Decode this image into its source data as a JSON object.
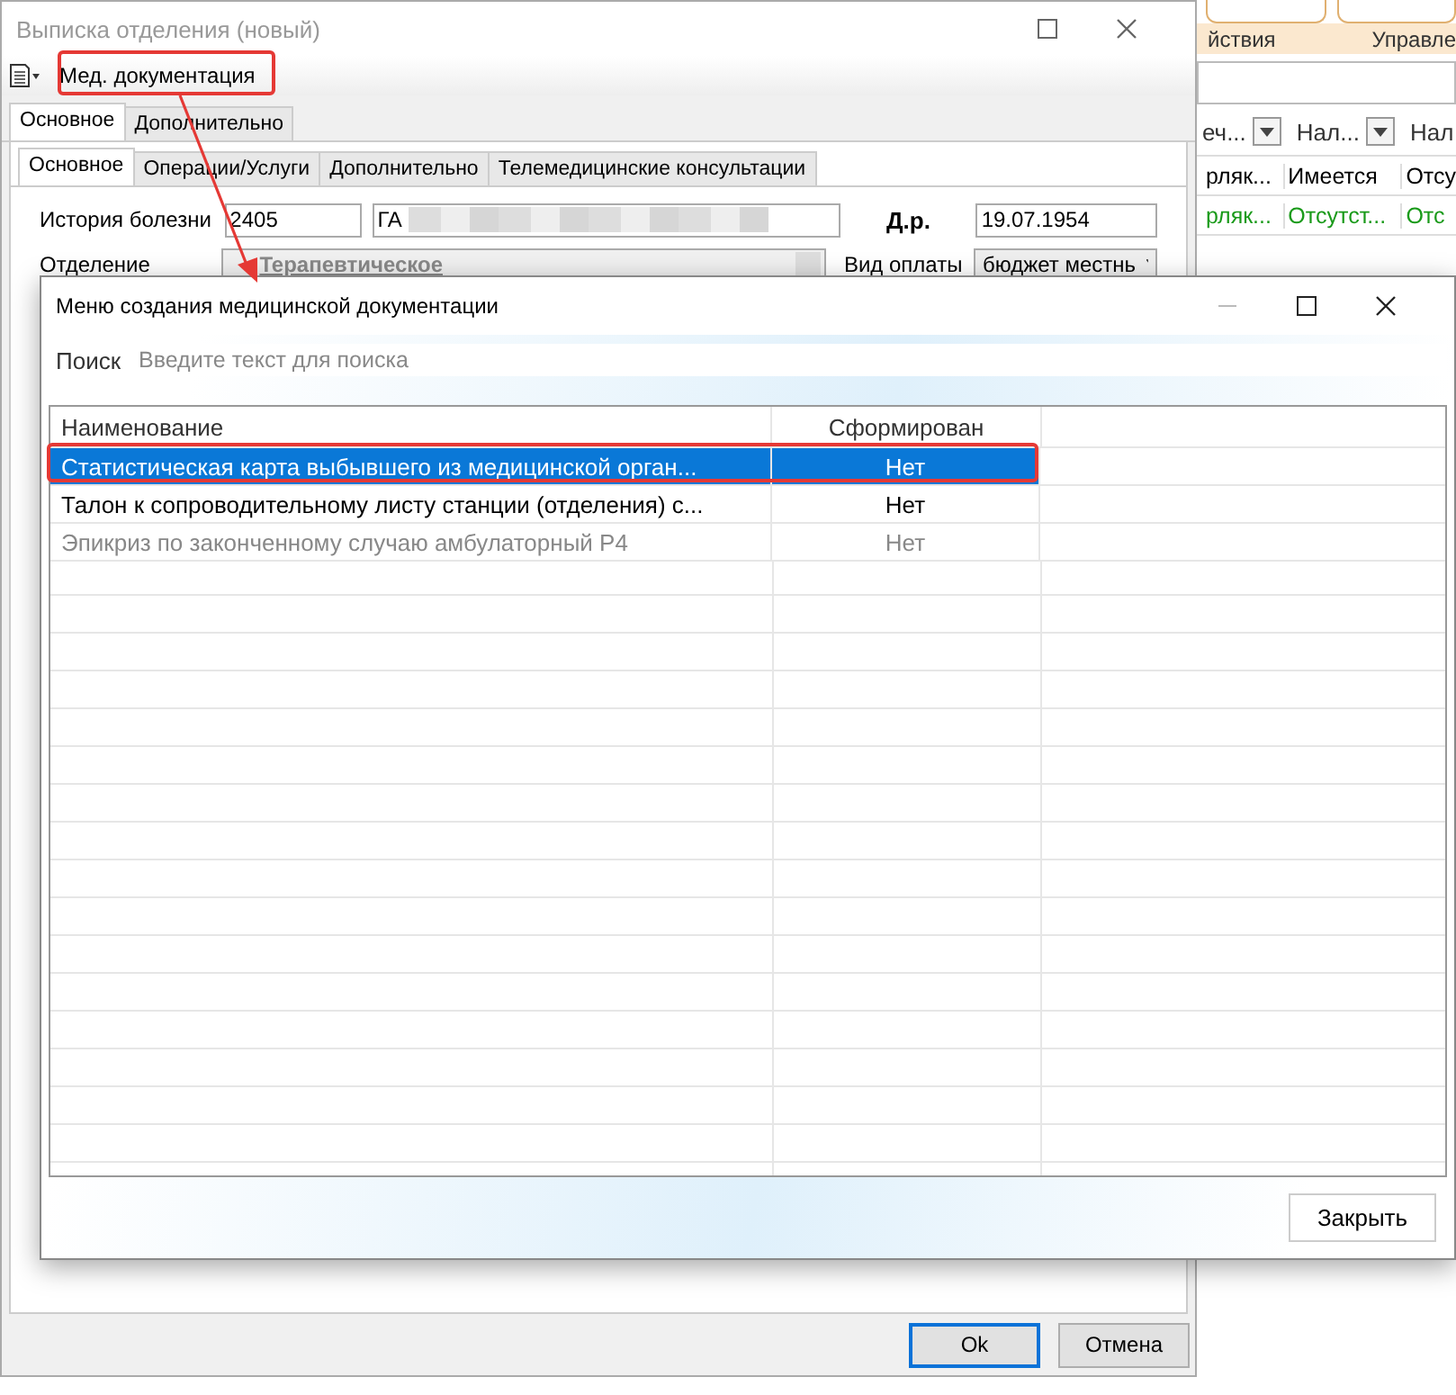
{
  "window": {
    "title": "Выписка отделения (новый)"
  },
  "toolbar": {
    "button": "Мед. документация"
  },
  "outer_tabs": [
    {
      "label": "Основное",
      "selected": true
    },
    {
      "label": "Дополнительно",
      "selected": false
    }
  ],
  "inner_tabs": [
    {
      "label": "Основное",
      "selected": true
    },
    {
      "label": "Операции/Услуги",
      "selected": false
    },
    {
      "label": "Дополнительно",
      "selected": false
    },
    {
      "label": "Телемедицинские консультации",
      "selected": false
    }
  ],
  "form": {
    "history_label": "История болезни",
    "history_number": "2405",
    "patient_name": "ГА",
    "birth_label": "Д.р.",
    "birth_date": "19.07.1954",
    "department_label": "Отделение",
    "department": "Терапевтическое",
    "payment_label": "Вид оплаты",
    "payment": "бюджет местнь"
  },
  "buttons": [
    {
      "label": "Ok",
      "focused": true
    },
    {
      "label": "Отмена",
      "focused": false
    }
  ],
  "background_app": {
    "tabs": [
      "йствия",
      "Управле"
    ],
    "columns": [
      "еч...",
      "Нал...",
      "Нал"
    ],
    "rows": [
      {
        "cells": [
          "рляк...",
          "Имеется",
          "Отсу"
        ],
        "color": "#000000"
      },
      {
        "cells": [
          "рляк...",
          "Отсутст...",
          "Отс"
        ],
        "color": "#1a9a1a"
      }
    ]
  },
  "dialog": {
    "title": "Меню создания медицинской документации",
    "search_label": "Поиск",
    "search_placeholder": "Введите текст для поиска",
    "columns": [
      "Наименование",
      "Сформирован"
    ],
    "rows": [
      {
        "name": "Статистическая карта выбывшего из медицинской орган...",
        "status": "Нет",
        "selected": true,
        "disabled": false
      },
      {
        "name": "Талон к сопроводительному листу станции (отделения) с...",
        "status": "Нет",
        "selected": false,
        "disabled": false
      },
      {
        "name": "Эпикриз по законченному случаю амбулаторный Р4",
        "status": "Нет",
        "selected": false,
        "disabled": true
      }
    ],
    "close_button": "Закрыть"
  }
}
